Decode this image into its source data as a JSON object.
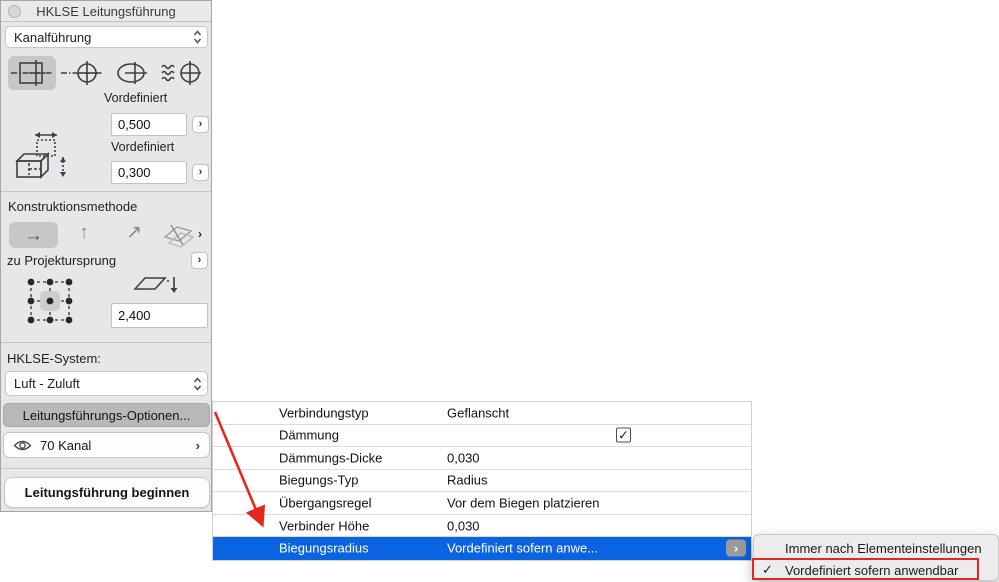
{
  "panel": {
    "title": "HKLSE Leitungsführung",
    "element_dropdown_value": "Kanalführung",
    "geometry": {
      "width_label": "Vordefiniert",
      "width_value": "0,500",
      "height_label": "Vordefiniert",
      "height_value": "0,300"
    },
    "construction": {
      "section_label": "Konstruktionsmethode",
      "origin_label": "zu Projektursprung",
      "elevation_value": "2,400"
    },
    "system": {
      "label": "HKLSE-System:",
      "dropdown_value": "Luft - Zuluft"
    },
    "buttons": {
      "options": "Leitungsführungs-Optionen...",
      "layer": "70 Kanal",
      "start": "Leitungsführung beginnen"
    }
  },
  "table": {
    "rows": [
      {
        "label": "Verbindungstyp",
        "value": "Geflanscht",
        "type": "text"
      },
      {
        "label": "Dämmung",
        "value": "",
        "type": "checkbox",
        "checked": true
      },
      {
        "label": "Dämmungs-Dicke",
        "value": "0,030",
        "type": "text"
      },
      {
        "label": "Biegungs-Typ",
        "value": "Radius",
        "type": "text"
      },
      {
        "label": "Übergangsregel",
        "value": "Vor dem Biegen platzieren",
        "type": "text"
      },
      {
        "label": "Verbinder Höhe",
        "value": "0,030",
        "type": "text"
      },
      {
        "label": "Biegungsradius",
        "value": "Vordefiniert sofern anwe...",
        "type": "text",
        "selected": true
      }
    ]
  },
  "context_menu": {
    "items": [
      {
        "label": "Immer nach Elementeinstellungen",
        "checked": false
      },
      {
        "label": "Vordefiniert sofern anwendbar",
        "checked": true,
        "highlighted": true
      }
    ]
  },
  "icons": {
    "chevron_right": "›",
    "checkmark": "✓",
    "arrow_right": "→",
    "arrow_up": "↑",
    "arrow_diag": "↗"
  },
  "colors": {
    "selection_blue": "#0a63e0",
    "annotation_red": "#e5271e",
    "panel_gray": "#e7e7e7"
  }
}
